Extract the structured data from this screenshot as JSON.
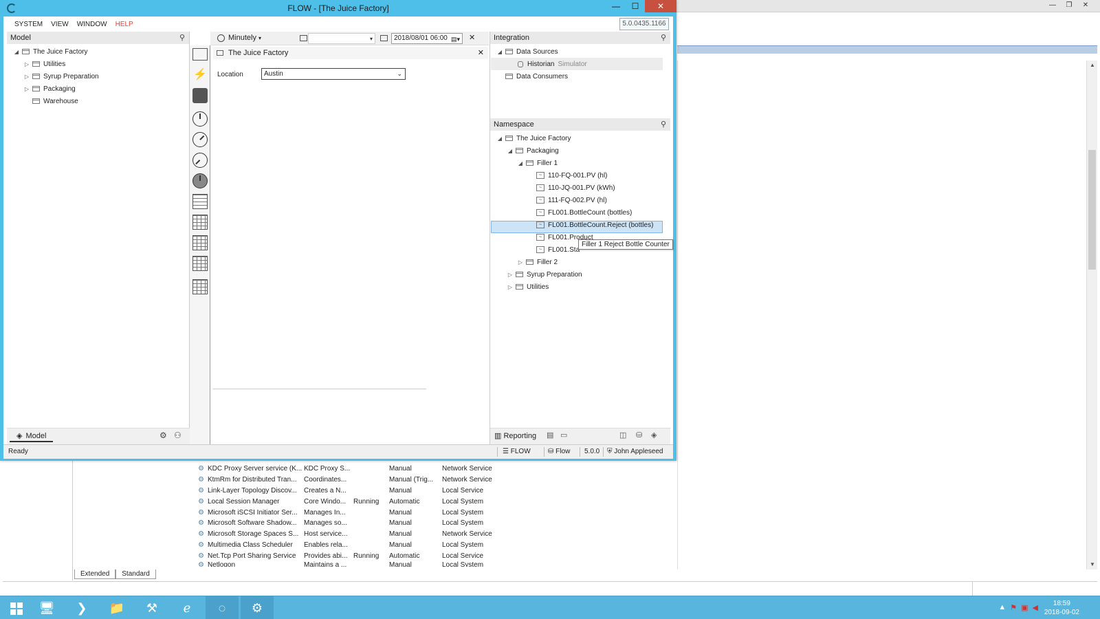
{
  "app": {
    "title": "FLOW - [The Juice Factory]",
    "version": "5.0.0435.1166",
    "menu": [
      "SYSTEM",
      "VIEW",
      "WINDOW",
      "HELP"
    ]
  },
  "model_panel": {
    "header": "Model",
    "tree": [
      {
        "label": "The Juice Factory",
        "toggle": "◢",
        "indent": 0
      },
      {
        "label": "Utilities",
        "toggle": "▷",
        "indent": 1
      },
      {
        "label": "Syrup Preparation",
        "toggle": "▷",
        "indent": 1
      },
      {
        "label": "Packaging",
        "toggle": "▷",
        "indent": 1
      },
      {
        "label": "Warehouse",
        "toggle": "",
        "indent": 1
      }
    ],
    "footer_tab": "Model"
  },
  "toolbar": {
    "interval": "Minutely",
    "date": "2018/08/01 06:00"
  },
  "document": {
    "title": "The Juice Factory",
    "location_label": "Location",
    "location_value": "Austin"
  },
  "integration": {
    "header": "Integration",
    "data_sources": "Data Sources",
    "historian": "Historian",
    "historian_type": "Simulator",
    "data_consumers": "Data Consumers"
  },
  "namespace": {
    "header": "Namespace",
    "root": "The Juice Factory",
    "packaging": "Packaging",
    "filler1": "Filler 1",
    "tags": [
      "110-FQ-001.PV (hl)",
      "110-JQ-001.PV (kWh)",
      "111-FQ-002.PV (hl)",
      "FL001.BottleCount (bottles)",
      "FL001.BottleCount.Reject (bottles)",
      "FL001.Product",
      "FL001.Sta"
    ],
    "filler2": "Filler 2",
    "syrup": "Syrup Preparation",
    "utilities": "Utilities",
    "tooltip": "Filler 1 Reject Bottle Counter"
  },
  "right_footer": {
    "reporting": "Reporting"
  },
  "status": {
    "ready": "Ready",
    "flow_upper": "FLOW",
    "flow": "Flow",
    "version": "5.0.0",
    "user": "John Appleseed"
  },
  "services": {
    "rows": [
      [
        "KDC Proxy Server service (K...",
        "KDC Proxy S...",
        "",
        "Manual",
        "Network Service"
      ],
      [
        "KtmRm for Distributed Tran...",
        "Coordinates...",
        "",
        "Manual (Trig...",
        "Network Service"
      ],
      [
        "Link-Layer Topology Discov...",
        "Creates a N...",
        "",
        "Manual",
        "Local Service"
      ],
      [
        "Local Session Manager",
        "Core Windo...",
        "Running",
        "Automatic",
        "Local System"
      ],
      [
        "Microsoft iSCSI Initiator Ser...",
        "Manages In...",
        "",
        "Manual",
        "Local System"
      ],
      [
        "Microsoft Software Shadow...",
        "Manages so...",
        "",
        "Manual",
        "Local System"
      ],
      [
        "Microsoft Storage Spaces S...",
        "Host service...",
        "",
        "Manual",
        "Network Service"
      ],
      [
        "Multimedia Class Scheduler",
        "Enables rela...",
        "",
        "Manual",
        "Local System"
      ],
      [
        "Net.Tcp Port Sharing Service",
        "Provides abi...",
        "Running",
        "Automatic",
        "Local Service"
      ],
      [
        "Netlogon",
        "Maintains a ...",
        "",
        "Manual",
        "Local System"
      ]
    ],
    "tabs": [
      "Extended",
      "Standard"
    ]
  },
  "taskbar": {
    "time": "18:59",
    "date": "2018-09-02"
  },
  "colors": {
    "accent": "#4dbfe8",
    "help": "#d9443a",
    "selection": "#cde4f7",
    "taskbar": "#58b5de"
  }
}
